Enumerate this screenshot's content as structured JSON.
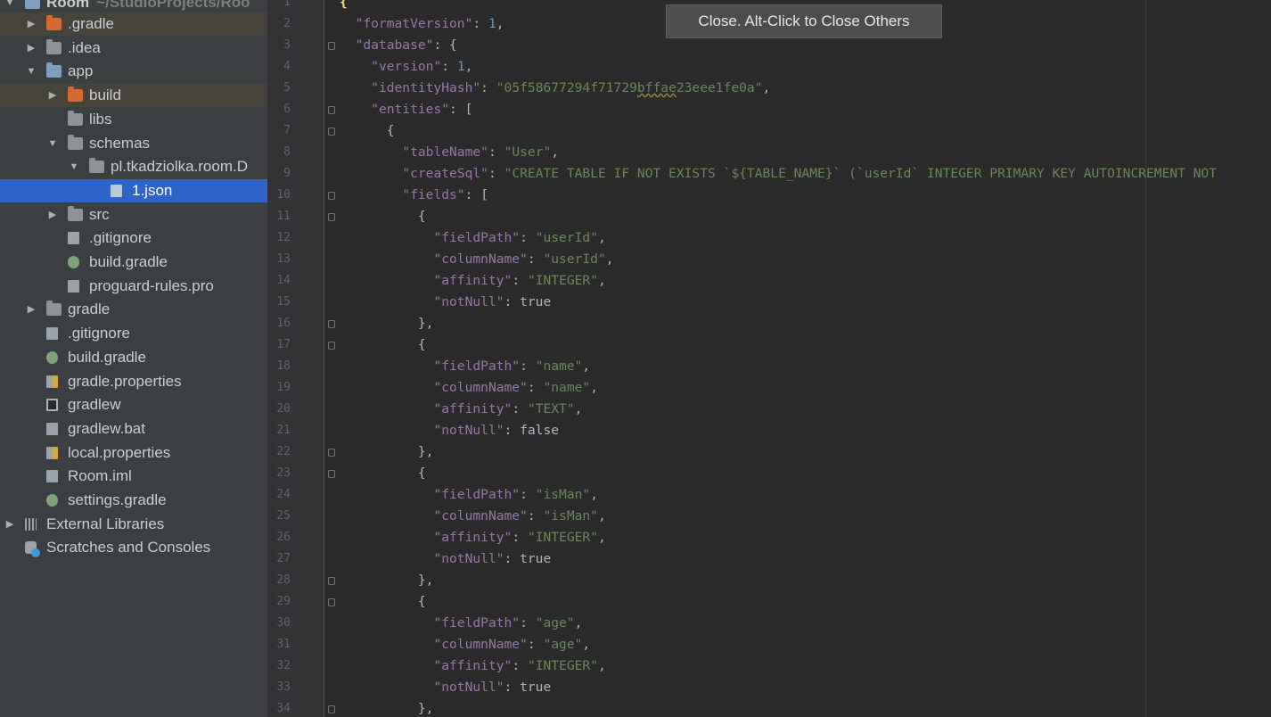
{
  "project_tree": {
    "root": {
      "label": "Room",
      "path": "~/StudioProjects/Roo"
    },
    "items": [
      {
        "label": ".gradle",
        "icon": "folder-orange-icon"
      },
      {
        "label": ".idea",
        "icon": "folder-icon"
      },
      {
        "label": "app",
        "icon": "module-folder-icon"
      },
      {
        "label": "build",
        "icon": "folder-orange-icon"
      },
      {
        "label": "libs",
        "icon": "folder-icon"
      },
      {
        "label": "schemas",
        "icon": "folder-icon"
      },
      {
        "label": "pl.tkadziolka.room.D",
        "icon": "folder-icon"
      },
      {
        "label": "1.json",
        "icon": "json-file-icon"
      },
      {
        "label": "src",
        "icon": "folder-icon"
      },
      {
        "label": ".gitignore",
        "icon": "gitignore-file-icon"
      },
      {
        "label": "build.gradle",
        "icon": "gradle-file-icon"
      },
      {
        "label": "proguard-rules.pro",
        "icon": "file-icon"
      },
      {
        "label": "gradle",
        "icon": "folder-icon"
      },
      {
        "label": ".gitignore",
        "icon": "gitignore-file-icon"
      },
      {
        "label": "build.gradle",
        "icon": "gradle-file-icon"
      },
      {
        "label": "gradle.properties",
        "icon": "properties-file-icon"
      },
      {
        "label": "gradlew",
        "icon": "shell-file-icon"
      },
      {
        "label": "gradlew.bat",
        "icon": "file-icon"
      },
      {
        "label": "local.properties",
        "icon": "properties-file-icon"
      },
      {
        "label": "Room.iml",
        "icon": "module-file-icon"
      },
      {
        "label": "settings.gradle",
        "icon": "gradle-file-icon"
      },
      {
        "label": "External Libraries",
        "icon": "libraries-icon"
      },
      {
        "label": "Scratches and Consoles",
        "icon": "scratches-icon"
      }
    ]
  },
  "tooltip": {
    "text": "Close. Alt-Click to Close Others"
  },
  "editor": {
    "first_line": 1,
    "lines": [
      "{",
      "  \"formatVersion\": 1,",
      "  \"database\": {",
      "    \"version\": 1,",
      "    \"identityHash\": \"05f58677294f71729bffae23eee1fe0a\",",
      "    \"entities\": [",
      "      {",
      "        \"tableName\": \"User\",",
      "        \"createSql\": \"CREATE TABLE IF NOT EXISTS `${TABLE_NAME}` (`userId` INTEGER PRIMARY KEY AUTOINCREMENT NOT",
      "        \"fields\": [",
      "          {",
      "            \"fieldPath\": \"userId\",",
      "            \"columnName\": \"userId\",",
      "            \"affinity\": \"INTEGER\",",
      "            \"notNull\": true",
      "          },",
      "          {",
      "            \"fieldPath\": \"name\",",
      "            \"columnName\": \"name\",",
      "            \"affinity\": \"TEXT\",",
      "            \"notNull\": false",
      "          },",
      "          {",
      "            \"fieldPath\": \"isMan\",",
      "            \"columnName\": \"isMan\",",
      "            \"affinity\": \"INTEGER\",",
      "            \"notNull\": true",
      "          },",
      "          {",
      "            \"fieldPath\": \"age\",",
      "            \"columnName\": \"age\",",
      "            \"affinity\": \"INTEGER\",",
      "            \"notNull\": true",
      "          },"
    ]
  },
  "colors": {
    "key": "#9876aa",
    "string": "#6a8759",
    "number": "#6897bb",
    "keyword": "#cc7832",
    "selection": "#2f65ca"
  }
}
